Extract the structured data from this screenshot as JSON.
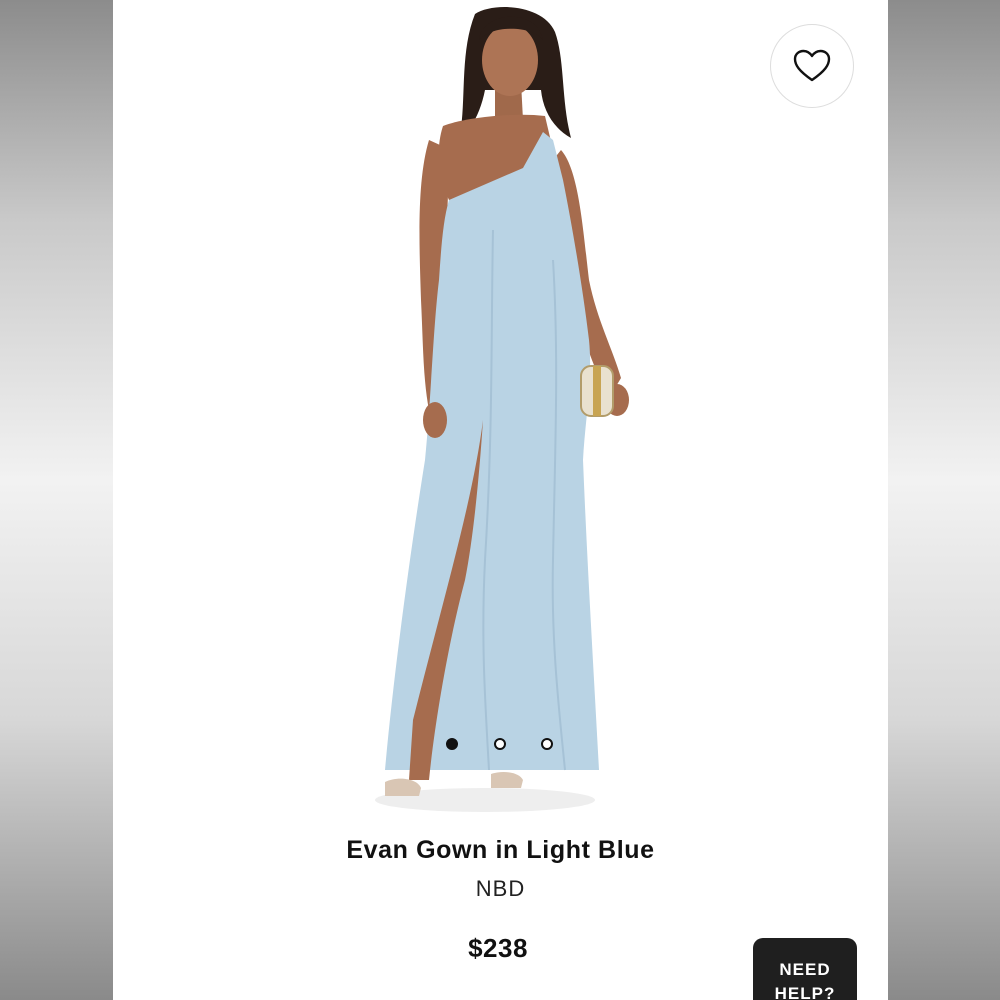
{
  "product": {
    "title": "Evan Gown in Light Blue",
    "brand": "NBD",
    "price": "$238"
  },
  "gallery": {
    "image_count": 3,
    "active_index": 0
  },
  "actions": {
    "favorite_icon": "heart-outline-icon",
    "help_label": "NEED HELP?"
  },
  "colors": {
    "dress": "#b9d3e4",
    "text": "#111111",
    "help_bg": "#1f1f1f"
  }
}
